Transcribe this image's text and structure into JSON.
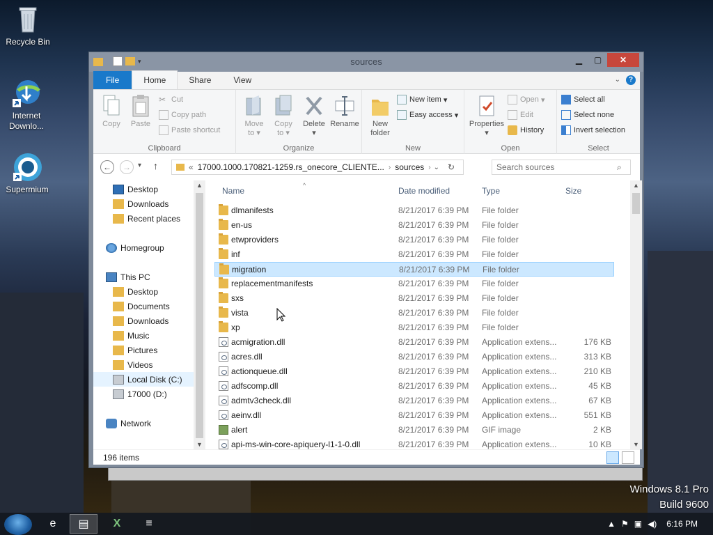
{
  "desktop": {
    "icons": [
      {
        "label": "Recycle Bin",
        "icon": "recycle-bin-icon"
      },
      {
        "label": "Internet Downlo...",
        "icon": "internet-download-manager-icon"
      },
      {
        "label": "Supermium",
        "icon": "supermium-browser-icon"
      }
    ],
    "watermark": {
      "line1": "Windows 8.1 Pro",
      "line2": "Build 9600"
    }
  },
  "window": {
    "title": "sources",
    "tabs": [
      {
        "label": "File"
      },
      {
        "label": "Home"
      },
      {
        "label": "Share"
      },
      {
        "label": "View"
      }
    ],
    "help_icon": "?",
    "ribbon": {
      "clipboard": {
        "label": "Clipboard",
        "copy": "Copy",
        "paste": "Paste",
        "cut": "Cut",
        "copy_path": "Copy path",
        "paste_shortcut": "Paste shortcut"
      },
      "organize": {
        "label": "Organize",
        "move_to": "Move to",
        "copy_to": "Copy to",
        "delete": "Delete",
        "rename": "Rename",
        "move_to_l1": "Move",
        "move_to_l2": "to",
        "copy_to_l1": "Copy",
        "copy_to_l2": "to"
      },
      "new": {
        "label": "New",
        "new_folder_l1": "New",
        "new_folder_l2": "folder",
        "new_item": "New item",
        "easy_access": "Easy access"
      },
      "open": {
        "label": "Open",
        "properties": "Properties",
        "open": "Open",
        "edit": "Edit",
        "history": "History"
      },
      "select": {
        "label": "Select",
        "select_all": "Select all",
        "select_none": "Select none",
        "invert_selection": "Invert selection"
      }
    },
    "address": {
      "prefix": "«",
      "crumbs": [
        "17000.1000.170821-1259.rs_onecore_CLIENTE...",
        "sources"
      ],
      "search_placeholder": "Search sources"
    },
    "nav_pane": {
      "items": [
        {
          "label": "Desktop",
          "icon": "desktop-icon"
        },
        {
          "label": "Downloads",
          "icon": "downloads-icon"
        },
        {
          "label": "Recent places",
          "icon": "recent-places-icon"
        },
        {
          "label": "Homegroup",
          "icon": "homegroup-icon"
        },
        {
          "label": "This PC",
          "icon": "this-pc-icon"
        },
        {
          "label": "Desktop",
          "icon": "desktop-icon"
        },
        {
          "label": "Documents",
          "icon": "documents-icon"
        },
        {
          "label": "Downloads",
          "icon": "downloads-icon"
        },
        {
          "label": "Music",
          "icon": "music-icon"
        },
        {
          "label": "Pictures",
          "icon": "pictures-icon"
        },
        {
          "label": "Videos",
          "icon": "videos-icon"
        },
        {
          "label": "Local Disk (C:)",
          "icon": "local-disk-icon"
        },
        {
          "label": "17000 (D:)",
          "icon": "dvd-drive-icon"
        },
        {
          "label": "Network",
          "icon": "network-icon"
        }
      ],
      "selected": "Local Disk (C:)"
    },
    "columns": [
      "Name",
      "Date modified",
      "Type",
      "Size"
    ],
    "files": [
      {
        "name": "dlmanifests",
        "date": "8/21/2017 6:39 PM",
        "type": "File folder",
        "size": "",
        "kind": "folder"
      },
      {
        "name": "en-us",
        "date": "8/21/2017 6:39 PM",
        "type": "File folder",
        "size": "",
        "kind": "folder"
      },
      {
        "name": "etwproviders",
        "date": "8/21/2017 6:39 PM",
        "type": "File folder",
        "size": "",
        "kind": "folder"
      },
      {
        "name": "inf",
        "date": "8/21/2017 6:39 PM",
        "type": "File folder",
        "size": "",
        "kind": "folder"
      },
      {
        "name": "migration",
        "date": "8/21/2017 6:39 PM",
        "type": "File folder",
        "size": "",
        "kind": "folder",
        "selected": true
      },
      {
        "name": "replacementmanifests",
        "date": "8/21/2017 6:39 PM",
        "type": "File folder",
        "size": "",
        "kind": "folder"
      },
      {
        "name": "sxs",
        "date": "8/21/2017 6:39 PM",
        "type": "File folder",
        "size": "",
        "kind": "folder"
      },
      {
        "name": "vista",
        "date": "8/21/2017 6:39 PM",
        "type": "File folder",
        "size": "",
        "kind": "folder"
      },
      {
        "name": "xp",
        "date": "8/21/2017 6:39 PM",
        "type": "File folder",
        "size": "",
        "kind": "folder"
      },
      {
        "name": "acmigration.dll",
        "date": "8/21/2017 6:39 PM",
        "type": "Application extens...",
        "size": "176 KB",
        "kind": "dll"
      },
      {
        "name": "acres.dll",
        "date": "8/21/2017 6:39 PM",
        "type": "Application extens...",
        "size": "313 KB",
        "kind": "dll"
      },
      {
        "name": "actionqueue.dll",
        "date": "8/21/2017 6:39 PM",
        "type": "Application extens...",
        "size": "210 KB",
        "kind": "dll"
      },
      {
        "name": "adfscomp.dll",
        "date": "8/21/2017 6:39 PM",
        "type": "Application extens...",
        "size": "45 KB",
        "kind": "dll"
      },
      {
        "name": "admtv3check.dll",
        "date": "8/21/2017 6:39 PM",
        "type": "Application extens...",
        "size": "67 KB",
        "kind": "dll"
      },
      {
        "name": "aeinv.dll",
        "date": "8/21/2017 6:39 PM",
        "type": "Application extens...",
        "size": "551 KB",
        "kind": "dll"
      },
      {
        "name": "alert",
        "date": "8/21/2017 6:39 PM",
        "type": "GIF image",
        "size": "2 KB",
        "kind": "gif"
      },
      {
        "name": "api-ms-win-core-apiquery-l1-1-0.dll",
        "date": "8/21/2017 6:39 PM",
        "type": "Application extens...",
        "size": "10 KB",
        "kind": "dll"
      }
    ],
    "status": {
      "item_count": "196 items"
    }
  },
  "taskbar": {
    "time": "6:16 PM",
    "apps": [
      {
        "icon": "internet-explorer-icon",
        "glyph": "e"
      },
      {
        "icon": "file-explorer-icon",
        "glyph": "▤"
      },
      {
        "icon": "excel-icon",
        "glyph": "X"
      },
      {
        "icon": "notepad-icon",
        "glyph": "≡"
      }
    ]
  },
  "colors": {
    "accent": "#1979ca",
    "selection": "#cce8ff",
    "window_frame": "#7e8a9a",
    "close_button": "#c7473c"
  }
}
